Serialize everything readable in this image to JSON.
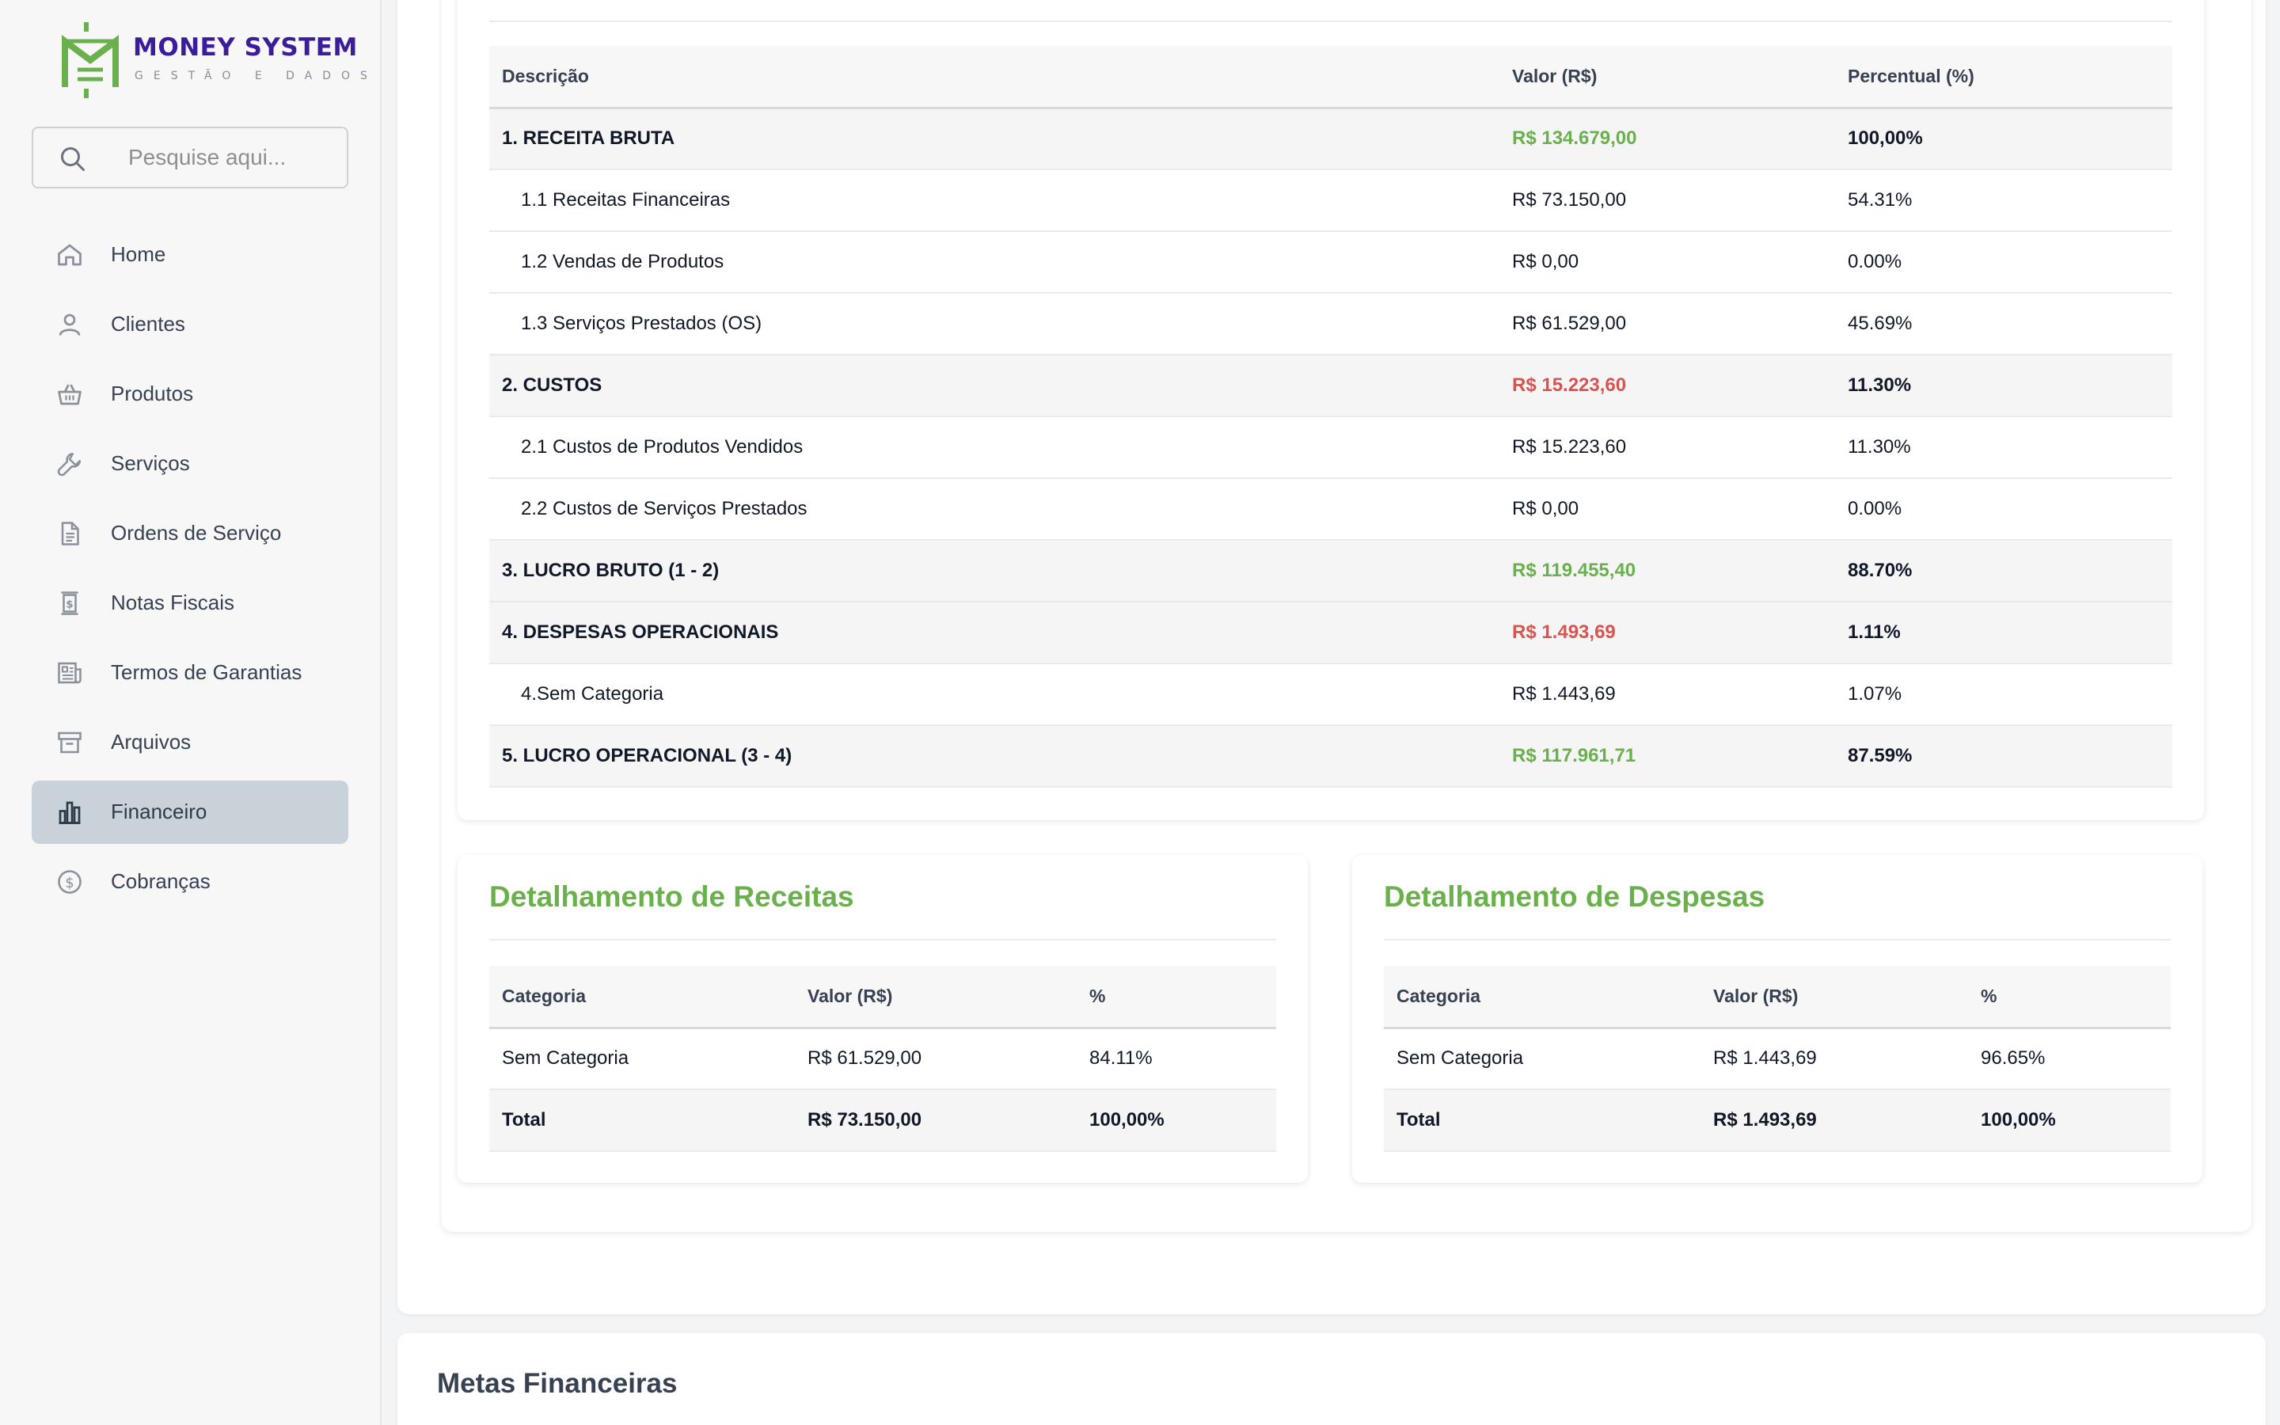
{
  "brand": {
    "title": "MONEY SYSTEM",
    "subtitle": "GESTÃO E DADOS",
    "colors": {
      "primary": "#3b1c9a",
      "accent": "#6ab04c"
    }
  },
  "search": {
    "placeholder": "Pesquise aqui..."
  },
  "nav": {
    "items": [
      {
        "label": "Home",
        "icon": "home-icon"
      },
      {
        "label": "Clientes",
        "icon": "user-icon"
      },
      {
        "label": "Produtos",
        "icon": "basket-icon"
      },
      {
        "label": "Serviços",
        "icon": "wrench-icon"
      },
      {
        "label": "Ordens de Serviço",
        "icon": "document-icon"
      },
      {
        "label": "Notas Fiscais",
        "icon": "invoice-icon"
      },
      {
        "label": "Termos de Garantias",
        "icon": "newspaper-icon"
      },
      {
        "label": "Arquivos",
        "icon": "archive-icon"
      },
      {
        "label": "Financeiro",
        "icon": "bar-chart-icon",
        "active": true
      },
      {
        "label": "Cobranças",
        "icon": "dollar-circle-icon"
      }
    ]
  },
  "dre": {
    "headers": {
      "desc": "Descrição",
      "value": "Valor (R$)",
      "percent": "Percentual (%)"
    },
    "rows": [
      {
        "desc": "1. RECEITA BRUTA",
        "value": "R$ 134.679,00",
        "percent": "100,00%",
        "group": true,
        "tone": "green"
      },
      {
        "desc": "1.1 Receitas Financeiras",
        "value": "R$ 73.150,00",
        "percent": "54.31%"
      },
      {
        "desc": "1.2 Vendas de Produtos",
        "value": "R$ 0,00",
        "percent": "0.00%"
      },
      {
        "desc": "1.3 Serviços Prestados (OS)",
        "value": "R$ 61.529,00",
        "percent": "45.69%"
      },
      {
        "desc": "2. CUSTOS",
        "value": "R$ 15.223,60",
        "percent": "11.30%",
        "group": true,
        "tone": "red"
      },
      {
        "desc": "2.1 Custos de Produtos Vendidos",
        "value": "R$ 15.223,60",
        "percent": "11.30%"
      },
      {
        "desc": "2.2 Custos de Serviços Prestados",
        "value": "R$ 0,00",
        "percent": "0.00%"
      },
      {
        "desc": "3. LUCRO BRUTO (1 - 2)",
        "value": "R$ 119.455,40",
        "percent": "88.70%",
        "group": true,
        "tone": "green"
      },
      {
        "desc": "4. DESPESAS OPERACIONAIS",
        "value": "R$ 1.493,69",
        "percent": "1.11%",
        "group": true,
        "tone": "red"
      },
      {
        "desc": "4.Sem Categoria",
        "value": "R$ 1.443,69",
        "percent": "1.07%"
      },
      {
        "desc": "5. LUCRO OPERACIONAL (3 - 4)",
        "value": "R$ 117.961,71",
        "percent": "87.59%",
        "group": true,
        "tone": "green"
      }
    ]
  },
  "receitas": {
    "title": "Detalhamento de Receitas",
    "headers": {
      "category": "Categoria",
      "value": "Valor (R$)",
      "percent": "%"
    },
    "rows": [
      {
        "category": "Sem Categoria",
        "value": "R$ 61.529,00",
        "percent": "84.11%"
      },
      {
        "category": "Total",
        "value": "R$ 73.150,00",
        "percent": "100,00%",
        "total": true
      }
    ]
  },
  "despesas": {
    "title": "Detalhamento de Despesas",
    "headers": {
      "category": "Categoria",
      "value": "Valor (R$)",
      "percent": "%"
    },
    "rows": [
      {
        "category": "Sem Categoria",
        "value": "R$ 1.443,69",
        "percent": "96.65%"
      },
      {
        "category": "Total",
        "value": "R$ 1.493,69",
        "percent": "100,00%",
        "total": true
      }
    ]
  },
  "metas": {
    "title": "Metas Financeiras"
  }
}
